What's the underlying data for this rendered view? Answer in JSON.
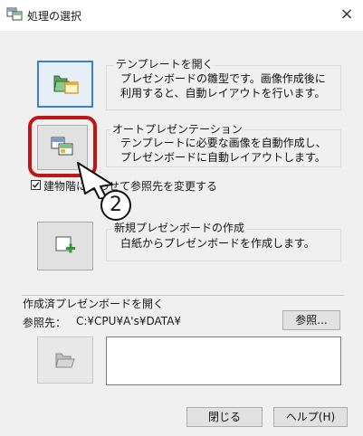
{
  "window": {
    "title": "処理の選択",
    "close_glyph": "×",
    "icon": "window-app-icon"
  },
  "template": {
    "group_label": "テンプレートを開く",
    "description_line1": "プレゼンボードの雛型です。画像作成後に",
    "description_line2": "利用すると、自動レイアウトを行います。",
    "icon": "template-folder-icon"
  },
  "auto_presentation": {
    "group_label": "オートプレゼンテーション",
    "description_line1": "テンプレートに必要な画像を自動作成し、",
    "description_line2": "プレゼンボードに自動レイアウトします。",
    "icon": "auto-presentation-icon"
  },
  "checkbox": {
    "label": "建物階に合わせて参照先を変更する",
    "checked": true
  },
  "callout": {
    "number": "2",
    "highlight_color": "#c01616"
  },
  "new_board": {
    "group_label": "新規プレゼンボードの作成",
    "description": "白紙からプレゼンボードを作成します。",
    "icon": "new-board-plus-icon"
  },
  "created": {
    "group_label": "作成済プレゼンボードを開く",
    "reference_label": "参照先：",
    "reference_path": "C:¥CPU¥A's¥DATA¥",
    "browse_label": "参照...",
    "open_icon": "folder-open-icon"
  },
  "footer": {
    "close_label": "閉じる",
    "help_label": "ヘルプ(H)"
  }
}
